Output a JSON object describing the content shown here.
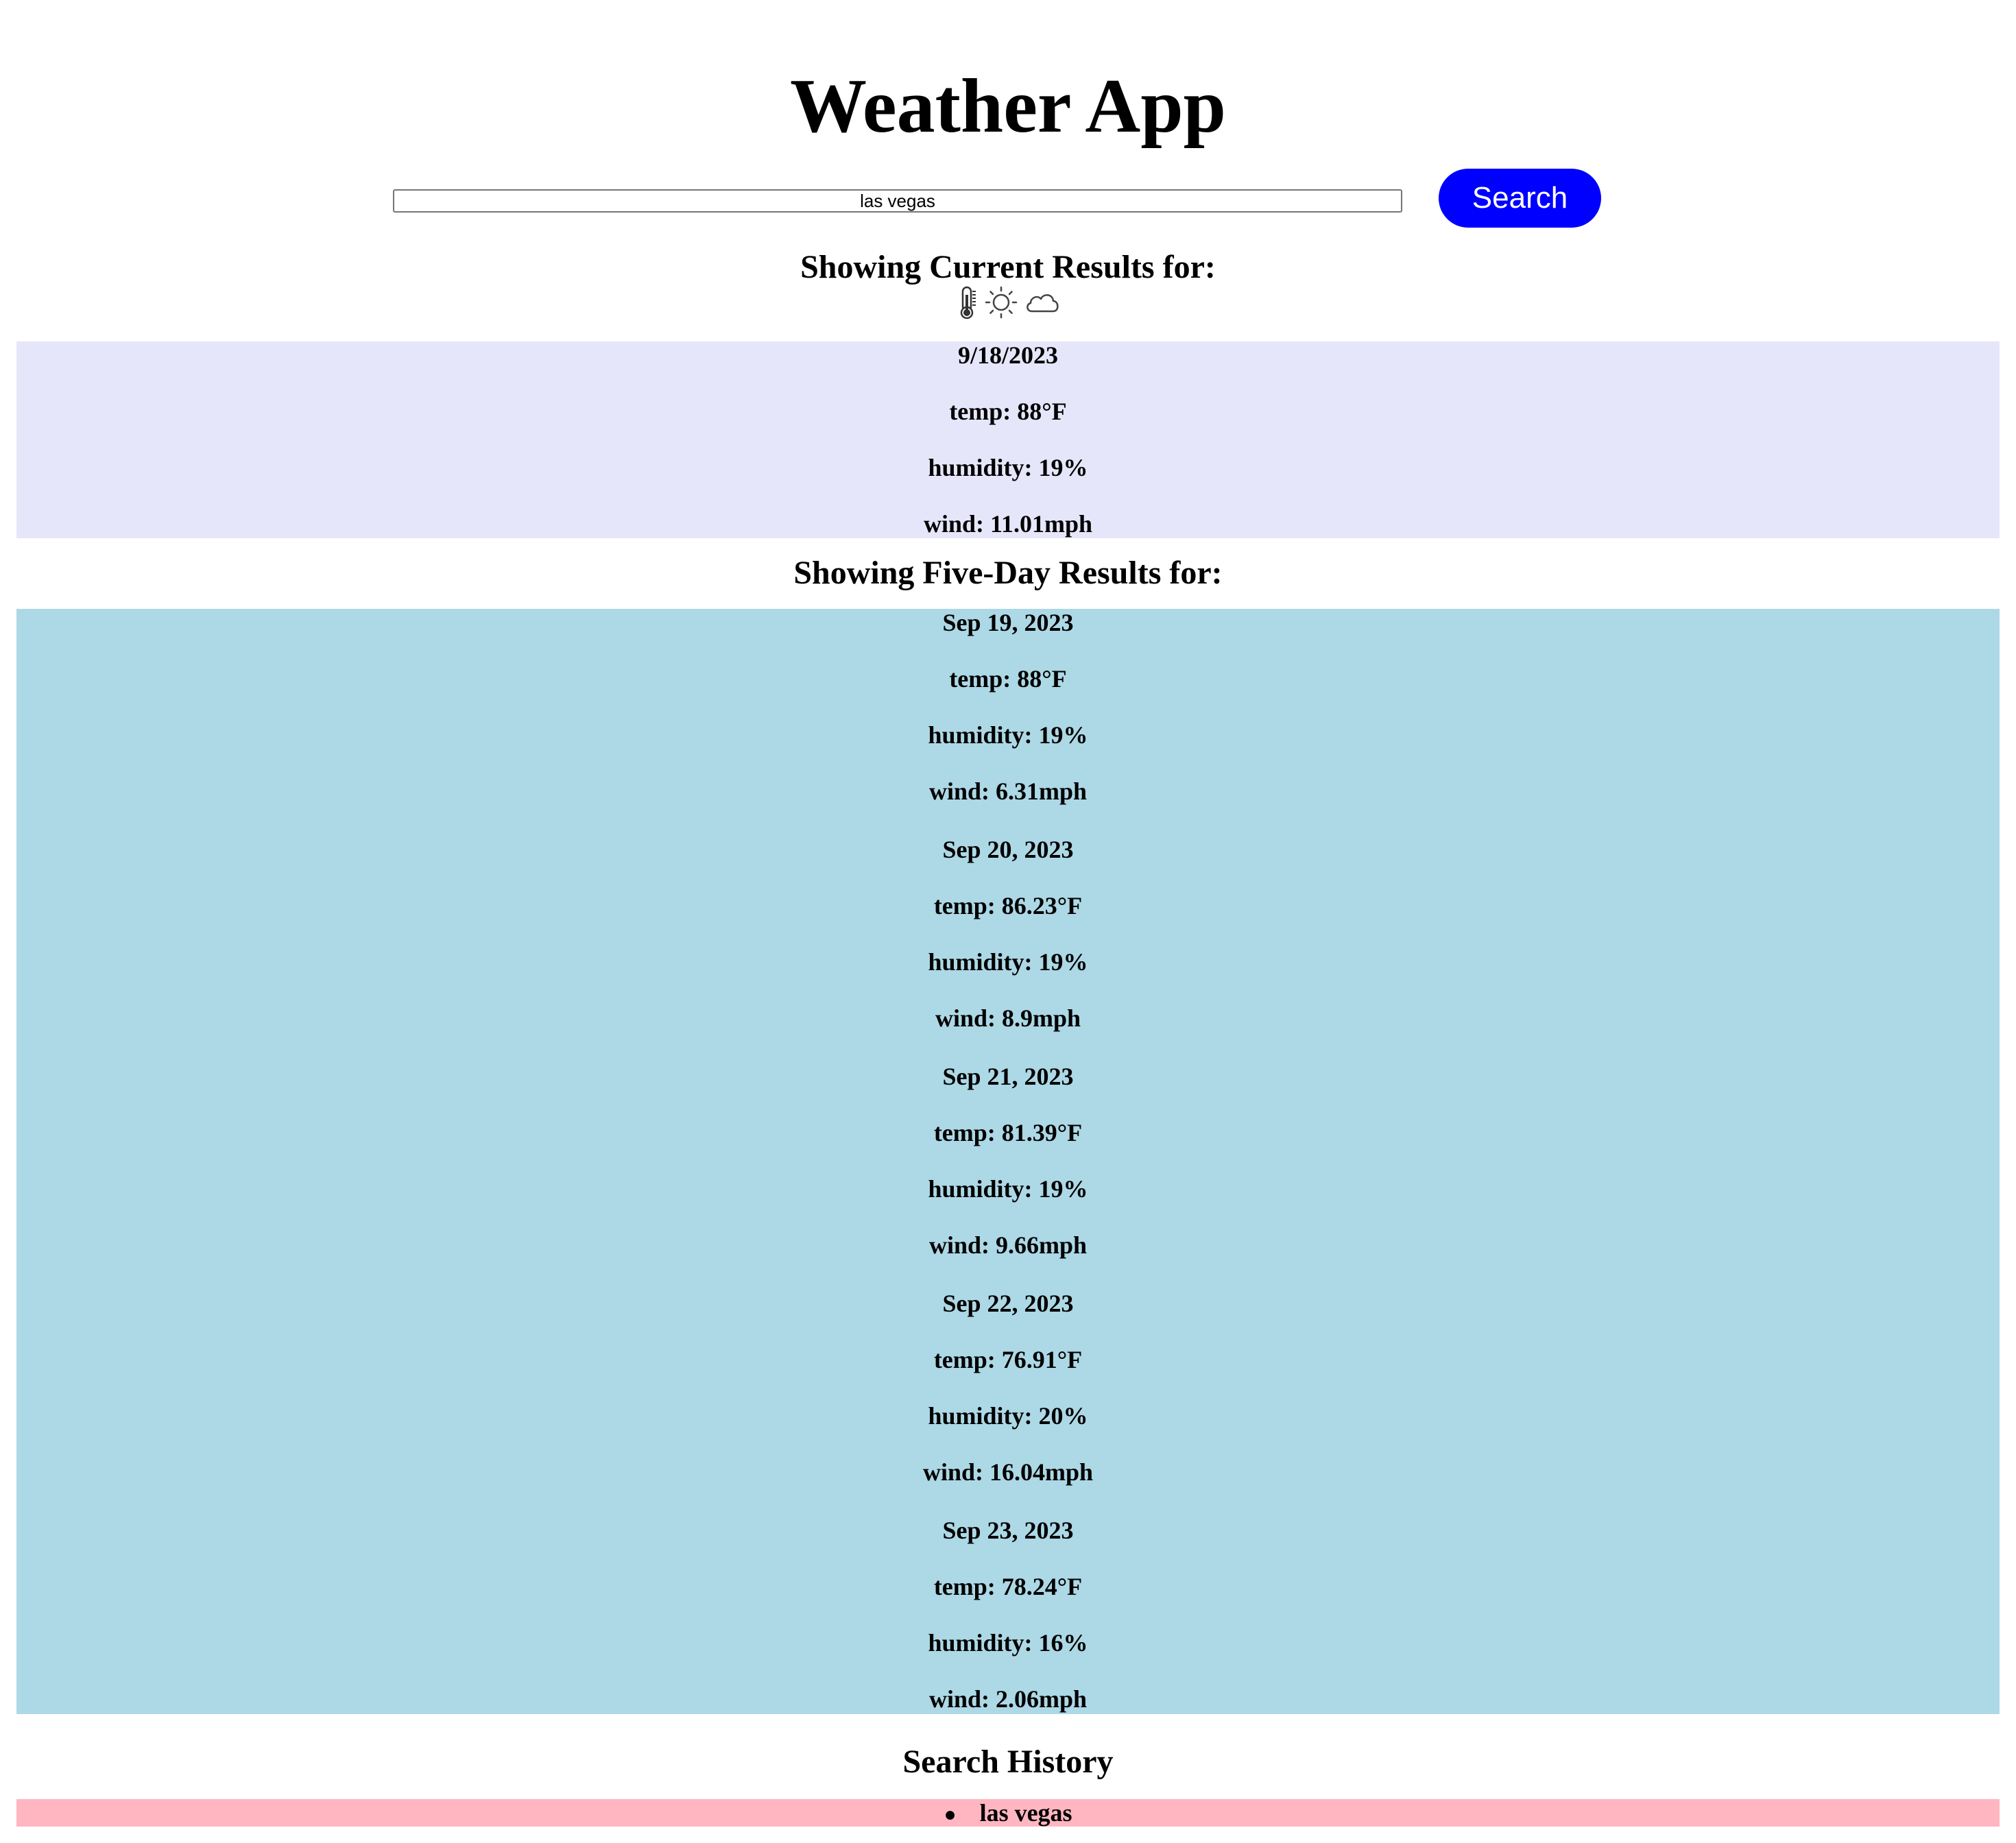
{
  "app": {
    "title": "Weather App"
  },
  "search": {
    "value": "las vegas",
    "button_label": "Search"
  },
  "current": {
    "heading": "Showing Current Results for:",
    "icons": [
      "thermometer-icon",
      "sun-icon",
      "cloud-icon"
    ],
    "date": "9/18/2023",
    "temp": "temp: 88°F",
    "humidity": "humidity: 19%",
    "wind": "wind: 11.01mph",
    "background": "#e6e6fa"
  },
  "forecast": {
    "heading": "Showing Five-Day Results for:",
    "background": "#add8e6",
    "days": [
      {
        "date": "Sep 19, 2023",
        "temp": "temp: 88°F",
        "humidity": "humidity: 19%",
        "wind": "wind: 6.31mph"
      },
      {
        "date": "Sep 20, 2023",
        "temp": "temp: 86.23°F",
        "humidity": "humidity: 19%",
        "wind": "wind: 8.9mph"
      },
      {
        "date": "Sep 21, 2023",
        "temp": "temp: 81.39°F",
        "humidity": "humidity: 19%",
        "wind": "wind: 9.66mph"
      },
      {
        "date": "Sep 22, 2023",
        "temp": "temp: 76.91°F",
        "humidity": "humidity: 20%",
        "wind": "wind: 16.04mph"
      },
      {
        "date": "Sep 23, 2023",
        "temp": "temp: 78.24°F",
        "humidity": "humidity: 16%",
        "wind": "wind: 2.06mph"
      }
    ]
  },
  "history": {
    "heading": "Search History",
    "background": "#ffb6c1",
    "items": [
      "las vegas"
    ]
  },
  "colors": {
    "search_button": "#0000ff",
    "search_button_text": "#ffffff"
  }
}
